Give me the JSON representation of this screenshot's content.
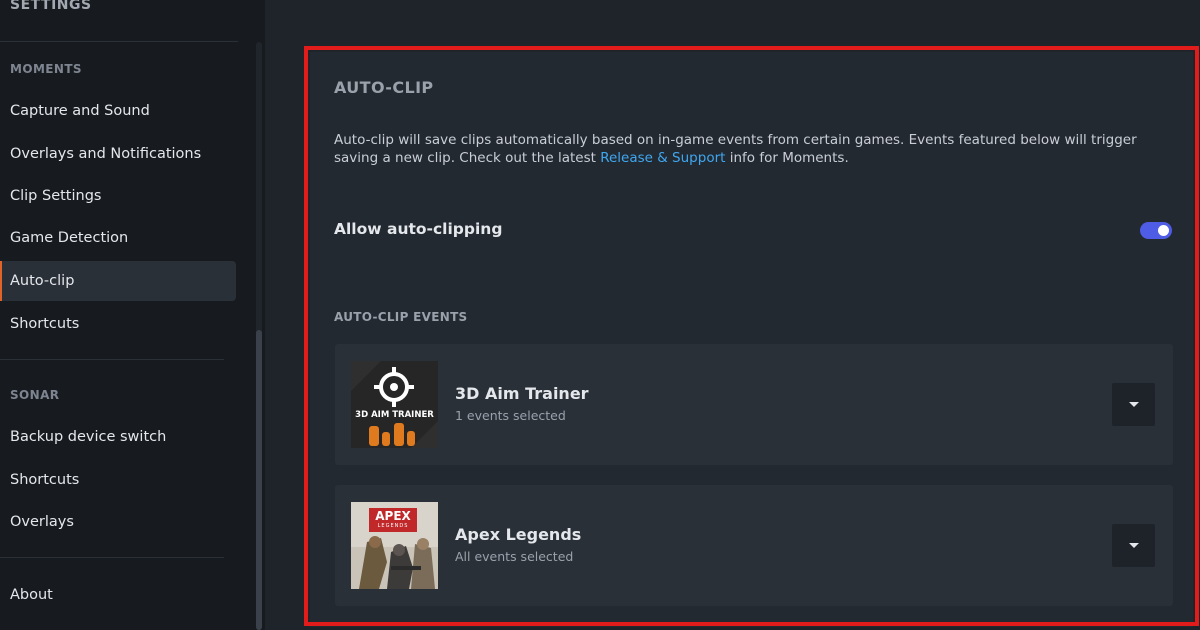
{
  "sidebar": {
    "title": "SETTINGS",
    "moments_section": "MOMENTS",
    "moments_items": [
      {
        "label": "Capture and Sound"
      },
      {
        "label": "Overlays and Notifications"
      },
      {
        "label": "Clip Settings"
      },
      {
        "label": "Game Detection"
      },
      {
        "label": "Auto-clip"
      },
      {
        "label": "Shortcuts"
      }
    ],
    "sonar_section": "SONAR",
    "sonar_items": [
      {
        "label": "Backup device switch"
      },
      {
        "label": "Shortcuts"
      },
      {
        "label": "Overlays"
      }
    ],
    "about_label": "About",
    "active_item": "Auto-clip"
  },
  "main": {
    "title": "AUTO-CLIP",
    "description_before": "Auto-clip will save clips automatically based on in-game events from certain games. Events featured below will trigger saving a new clip. Check out the latest ",
    "description_link": "Release & Support",
    "description_after": " info for Moments.",
    "allow_label": "Allow auto-clipping",
    "allow_enabled": true,
    "events_heading": "AUTO-CLIP EVENTS",
    "games": [
      {
        "name": "3D Aim Trainer",
        "status": "1 events selected",
        "thumb_text": "3D AIM TRAINER",
        "icon": "crosshair-icon"
      },
      {
        "name": "Apex Legends",
        "status": "All events selected",
        "thumb_text": "APEX",
        "thumb_subtext": "LEGENDS",
        "icon": "apex-logo"
      }
    ]
  },
  "colors": {
    "accent_toggle": "#4e5ce6",
    "link": "#3fa7f0",
    "highlight_border": "#e21b1b",
    "active_indicator": "#e0642a"
  }
}
